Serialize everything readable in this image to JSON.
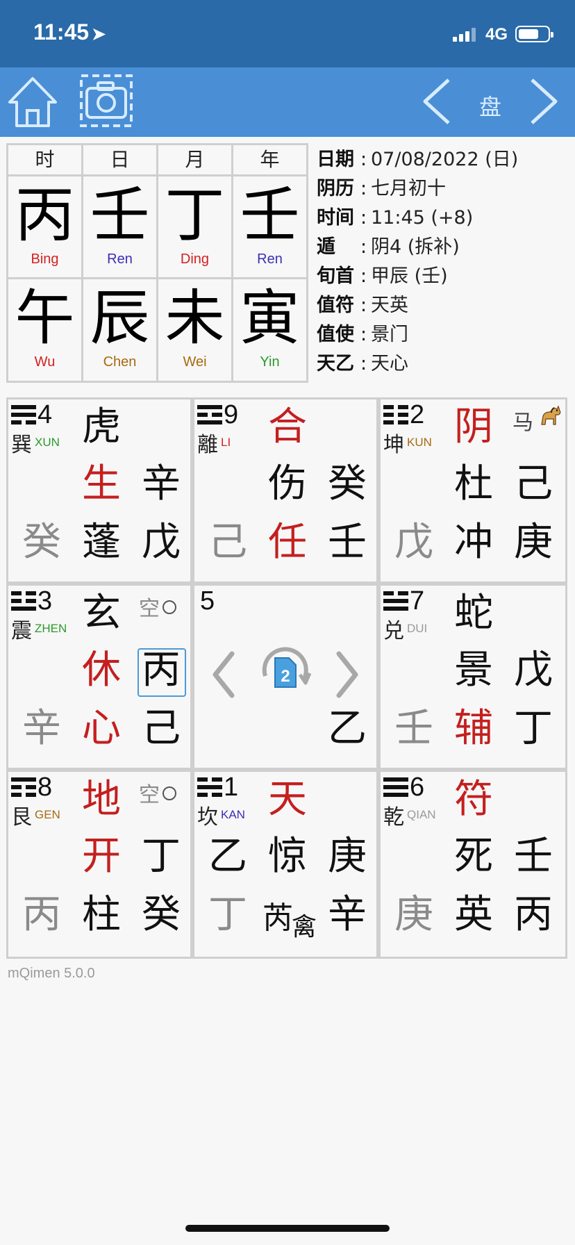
{
  "status_bar": {
    "time": "11:45",
    "location_icon": "location-arrow-icon",
    "network": "4G",
    "battery_icon": "battery-icon",
    "signal_icon": "signal-icon"
  },
  "toolbar": {
    "home_icon": "home-icon",
    "camera_icon": "camera-icon",
    "prev_icon": "chevron-left-icon",
    "next_icon": "chevron-right-icon",
    "title": "盘"
  },
  "colors": {
    "status_bar": "#2a6aa8",
    "toolbar": "#4a8ed6",
    "red": "#c41f1f",
    "gray": "#8a8a8a",
    "highlight": "#4a9ad8"
  },
  "pillars": [
    {
      "header": "时",
      "stem": "丙",
      "stem_pinyin": "Bing",
      "stem_color": "#d42020",
      "branch": "午",
      "branch_pinyin": "Wu",
      "branch_color": "#d42020"
    },
    {
      "header": "日",
      "stem": "壬",
      "stem_pinyin": "Ren",
      "stem_color": "#3a2fb5",
      "branch": "辰",
      "branch_pinyin": "Chen",
      "branch_color": "#a86a10"
    },
    {
      "header": "月",
      "stem": "丁",
      "stem_pinyin": "Ding",
      "stem_color": "#d42020",
      "branch": "未",
      "branch_pinyin": "Wei",
      "branch_color": "#a86a10"
    },
    {
      "header": "年",
      "stem": "壬",
      "stem_pinyin": "Ren",
      "stem_color": "#3a2fb5",
      "branch": "寅",
      "branch_pinyin": "Yin",
      "branch_color": "#2a9a2a"
    }
  ],
  "info": [
    {
      "label": "日期",
      "value": "07/08/2022 (日)"
    },
    {
      "label": "阴历",
      "value": "七月初十"
    },
    {
      "label": "时间",
      "value": "11:45 (+8)"
    },
    {
      "label": "遁",
      "value": "阴4 (拆补)"
    },
    {
      "label": "旬首",
      "value": "甲辰 (壬)"
    },
    {
      "label": "值符",
      "value": "天英"
    },
    {
      "label": "值使",
      "value": "景门"
    },
    {
      "label": "天乙",
      "value": "天心"
    }
  ],
  "info_colon": ":",
  "palaces": {
    "xun": {
      "num": "4",
      "gua": "巽",
      "pinyin": "XUN",
      "pinyin_color": "#2a9a2a",
      "top_mid": "虎",
      "mid_mid": "生",
      "mid_right": "辛",
      "bot_left": "癸",
      "bot_mid": "蓬",
      "bot_right": "戊"
    },
    "li": {
      "num": "9",
      "gua": "離",
      "pinyin": "LI",
      "pinyin_color": "#d42020",
      "top_mid": "合",
      "mid_mid": "伤",
      "mid_right": "癸",
      "bot_left": "己",
      "bot_mid": "任",
      "bot_right": "壬"
    },
    "kun": {
      "num": "2",
      "gua": "坤",
      "pinyin": "KUN",
      "pinyin_color": "#a86a10",
      "top_mid": "阴",
      "mid_mid": "杜",
      "mid_right": "己",
      "bot_left": "戊",
      "bot_mid": "冲",
      "bot_right": "庚",
      "ma": "马",
      "horse_icon": "horse-icon"
    },
    "zhen": {
      "num": "3",
      "gua": "震",
      "pinyin": "ZHEN",
      "pinyin_color": "#2a9a2a",
      "top_mid": "玄",
      "mid_mid": "休",
      "mid_right": "丙",
      "bot_left": "辛",
      "bot_mid": "心",
      "bot_right": "己",
      "kong": "空"
    },
    "center": {
      "num": "5",
      "bot_right": "乙",
      "rotate_badge": "2",
      "prev_icon": "chevron-left-icon",
      "next_icon": "chevron-right-icon",
      "rotate_icon": "rotate-document-icon"
    },
    "dui": {
      "num": "7",
      "gua": "兑",
      "pinyin": "DUI",
      "pinyin_color": "#9a9a9a",
      "top_mid": "蛇",
      "mid_mid": "景",
      "mid_right": "戊",
      "bot_left": "壬",
      "bot_mid": "辅",
      "bot_right": "丁"
    },
    "gen": {
      "num": "8",
      "gua": "艮",
      "pinyin": "GEN",
      "pinyin_color": "#a86a10",
      "top_mid": "地",
      "mid_mid": "开",
      "mid_right": "丁",
      "bot_left": "丙",
      "bot_mid": "柱",
      "bot_right": "癸",
      "kong": "空"
    },
    "kan": {
      "num": "1",
      "gua": "坎",
      "pinyin": "KAN",
      "pinyin_color": "#3a2fb5",
      "top_mid": "天",
      "mid_left": "乙",
      "mid_mid": "惊",
      "mid_right": "庚",
      "bot_left": "丁",
      "bot_mid_a": "芮",
      "bot_mid_b": "禽",
      "bot_right": "辛"
    },
    "qian": {
      "num": "6",
      "gua": "乾",
      "pinyin": "QIAN",
      "pinyin_color": "#9a9a9a",
      "top_mid": "符",
      "mid_mid": "死",
      "mid_right": "壬",
      "bot_left": "庚",
      "bot_mid": "英",
      "bot_right": "丙"
    }
  },
  "footer": {
    "version": "mQimen 5.0.0"
  }
}
